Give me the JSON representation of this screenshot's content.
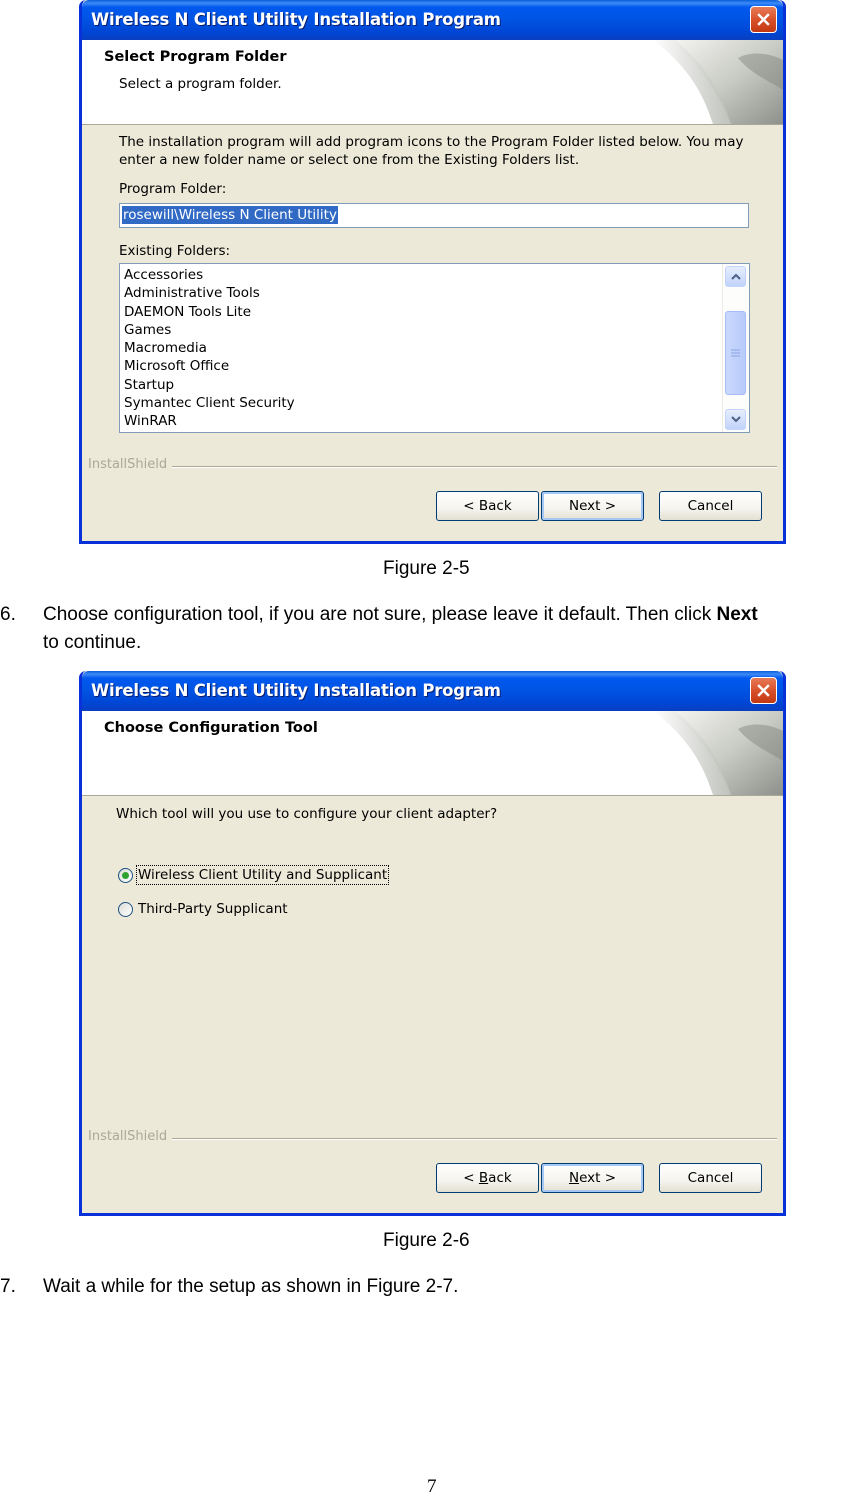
{
  "figure5": {
    "window_title": "Wireless N Client Utility Installation Program",
    "header_title": "Select Program Folder",
    "header_subtitle": "Select a program folder.",
    "description_line1": "The installation program will add program icons to the Program Folder listed below. You may",
    "description_line2": "enter a new folder name or select one from the Existing Folders list.",
    "program_folder_label": "Program Folder:",
    "program_folder_value": "rosewill\\Wireless N Client Utility",
    "existing_folders_label": "Existing Folders:",
    "existing_folders": [
      "Accessories",
      "Administrative Tools",
      "DAEMON Tools Lite",
      "Games",
      "Macromedia",
      "Microsoft Office",
      "Startup",
      "Symantec Client Security",
      "WinRAR"
    ],
    "installshield_label": "InstallShield",
    "back_button": "< Back",
    "next_button": "Next >",
    "cancel_button": "Cancel",
    "caption": "Figure 2-5"
  },
  "step6": {
    "number": "6.",
    "text_prefix": "Choose configuration tool, if you are not sure, please leave it default. Then click ",
    "text_bold": "Next",
    "text_line2": "to continue."
  },
  "figure6": {
    "window_title": "Wireless N Client Utility Installation Program",
    "header_title": "Choose Configuration Tool",
    "question": "Which tool will you use to configure your client adapter?",
    "options": [
      {
        "label": "Wireless Client Utility and Supplicant",
        "selected": true
      },
      {
        "label": "Third-Party Supplicant",
        "selected": false
      }
    ],
    "installshield_label": "InstallShield",
    "back_prefix": "< ",
    "back_mnemonic": "B",
    "back_rest": "ack",
    "next_mnemonic": "N",
    "next_rest": "ext >",
    "cancel_button": "Cancel",
    "caption": "Figure 2-6"
  },
  "step7": {
    "number": "7.",
    "text": "Wait a while for the setup as shown in Figure 2-7."
  },
  "page_number": "7",
  "colors": {
    "titlebar": "#0055e5",
    "dialog_face": "#ece9d8",
    "selection": "#316ac5",
    "radio_dot": "#2ea12e"
  }
}
